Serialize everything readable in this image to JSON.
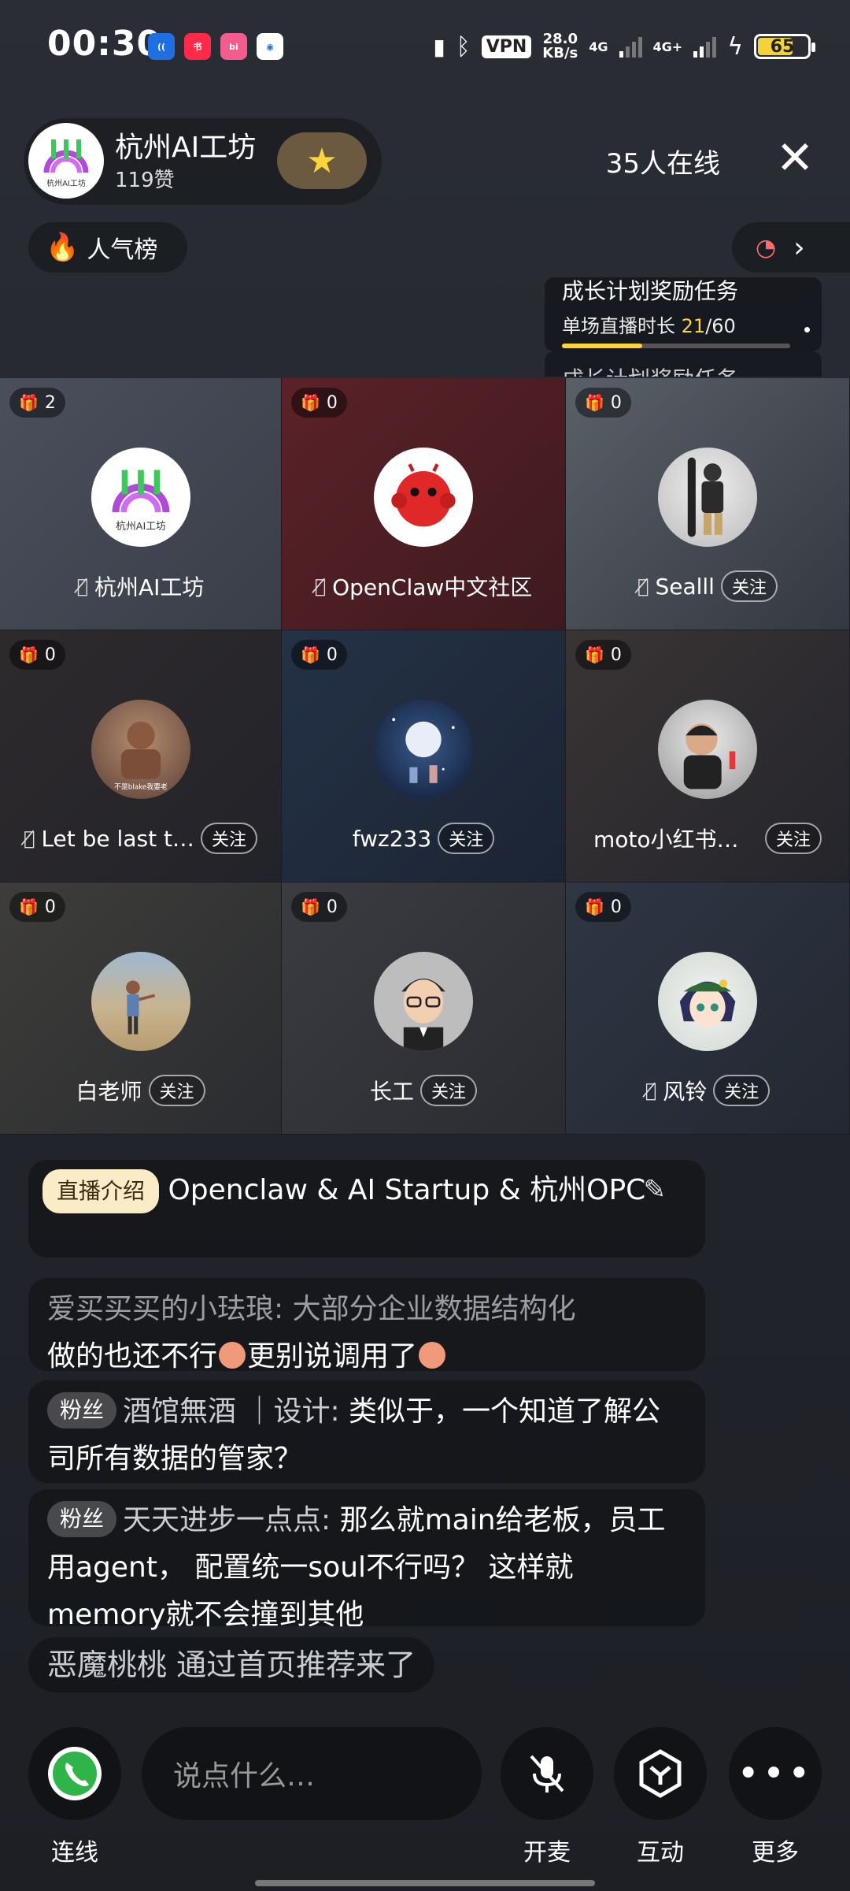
{
  "status_bar": {
    "time": "00:30",
    "vpn": "VPN",
    "speed_value": "28.0",
    "speed_unit": "KB/s",
    "net1": "4G",
    "net2": "4G+",
    "battery": "65"
  },
  "room": {
    "name": "杭州AI工坊",
    "likes": "119赞",
    "online": "35人在线",
    "popular_label": "人气榜"
  },
  "task": {
    "title": "成长计划奖励任务",
    "subtitle_prefix": "单场直播时长 ",
    "progress_current": "21",
    "progress_total": "/60",
    "progress_fraction": 0.35,
    "next_title": "成长计划奖励任务"
  },
  "participants": [
    {
      "name": "杭州AI工坊",
      "gifts": "2",
      "muted": true,
      "follow": false
    },
    {
      "name": "OpenClaw中文社区",
      "gifts": "0",
      "muted": true,
      "follow": false
    },
    {
      "name": "Sealll",
      "gifts": "0",
      "muted": true,
      "follow": true
    },
    {
      "name": "Let be last t…",
      "gifts": "0",
      "muted": true,
      "follow": true
    },
    {
      "name": "fwz233",
      "gifts": "0",
      "muted": false,
      "follow": true
    },
    {
      "name": "moto小红书非…",
      "gifts": "0",
      "muted": false,
      "follow": true
    },
    {
      "name": "白老师",
      "gifts": "0",
      "muted": false,
      "follow": true
    },
    {
      "name": "长工",
      "gifts": "0",
      "muted": false,
      "follow": true
    },
    {
      "name": "风铃",
      "gifts": "0",
      "muted": true,
      "follow": true
    }
  ],
  "follow_label": "关注",
  "avatar_texts": {
    "logo_text": "杭州AI工坊",
    "caption_4": "不是blake我要老"
  },
  "intro": {
    "tag": "直播介绍",
    "text": "Openclaw & AI Startup & 杭州OPC"
  },
  "messages": [
    {
      "user": "爱买买买的小珐琅: ",
      "text1": "大部分企业数据结构化",
      "text2": "做的也还不行",
      "text3": "更别说调用了"
    },
    {
      "badge": "粉丝",
      "user": "酒馆無酒 ｜设计: ",
      "text": "类似于，一个知道了解公司所有数据的管家？"
    },
    {
      "badge": "粉丝",
      "user": "天天进步一点点: ",
      "text": "那么就main给老板，员工用agent， 配置统一soul不行吗？ 这样就memory就不会撞到其他"
    }
  ],
  "enter_note": "恶魔桃桃 通过首页推荐来了",
  "bottom": {
    "connect": "连线",
    "input_placeholder": "说点什么…",
    "mic": "开麦",
    "interact": "互动",
    "more": "更多"
  }
}
